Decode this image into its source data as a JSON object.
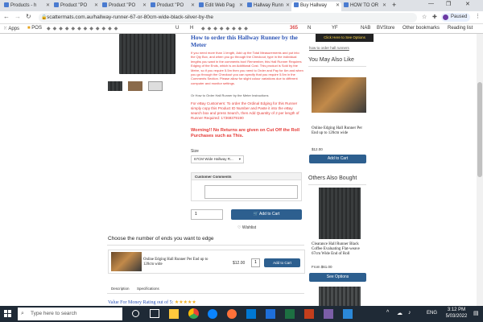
{
  "tabs": [
    {
      "label": "Products - h"
    },
    {
      "label": "Product \"PO"
    },
    {
      "label": "Product \"PO"
    },
    {
      "label": "Product \"PO"
    },
    {
      "label": "Edit Web Pag"
    },
    {
      "label": "Hallway Runn"
    },
    {
      "label": "Buy Hallway"
    },
    {
      "label": "HOW TO OR"
    }
  ],
  "browser": {
    "url": "scattermats.com.au/hallway-runner-67-or-80cm-wide-black-silver-by-the",
    "profile": "Paused"
  },
  "bookmarks": [
    {
      "label": "Apps"
    },
    {
      "label": "POS"
    },
    {
      "label": "U"
    },
    {
      "label": "H"
    },
    {
      "label": "365"
    },
    {
      "label": "N"
    },
    {
      "label": "YF"
    },
    {
      "label": "NAB"
    },
    {
      "label": "BVStore"
    }
  ],
  "bookmarks_right": {
    "other": "Other bookmarks",
    "reading": "Reading list"
  },
  "product": {
    "heading": "How to order this Hallway Runner by the Meter",
    "instructions": "If you need more than 1 length, Add up the Total Measurements and put into the Qty Box, and when you go through the Checkout, type in the individual lengths you want in the comments box! Remember, this Hall Runner Requires Edging of the Ends, which is an Additional Cost. This product is Sold by the Metre, so if you require 5.5m then you need to Order and Pay for 6m and when you go through the Checkout you can specify that you require 5.5m in the Comments Section. Please allow for slight colour variations due to different computer and monitor settings.",
    "link": "Or How to Order Hall Runner by the Meter Instructions",
    "ebay": "For eBay Customers: To order the Ordinal Edging for this Runner simply copy this Product ID Number and Paste it into the eBay search box and press Search, then Add Quantity of 2 per length of Runner Required: 17369379190",
    "warning": "Worning!! No Returns are given on Cut Off the Roll Purchases such as This.",
    "size_label": "Size",
    "size_value": "67CM Wide Hallway R...",
    "comments_label": "Customer Comments",
    "qty": "1",
    "add_to_cart": "Add to Cart",
    "wishlist": "Wishlist"
  },
  "edges": {
    "title": "Choose the number of ends you want to edge",
    "item_name": "Online Edging Hall Runner Per End up to 120cm wide",
    "price": "$12.00",
    "qty": "1",
    "add": "Add to Cart"
  },
  "tabs_section": {
    "description": "Description",
    "specs": "Specifications"
  },
  "rating": {
    "label": "Value For Money Rating out of 5:",
    "stars": "★★★★★"
  },
  "sidebar": {
    "banner": "Click Here to See Options",
    "banner_link": "how to order hall runners",
    "also_like": "You May Also Like",
    "also_like_item": "Online Edging Hall Runner Per End up to 120cm wide",
    "also_like_price": "$12.00",
    "also_like_btn": "Add to Cart",
    "also_bought": "Others Also Bought",
    "also_bought_item": "Clearance Hall Runner Black Coffee Evaluating Flat-weave 67cm Wide End of Roll",
    "also_bought_price": "From $61.00",
    "also_bought_btn": "See Options"
  },
  "taskbar": {
    "search": "Type here to search",
    "lang": "ENG",
    "time": "3:12 PM",
    "date": "5/03/2022"
  },
  "colors": {
    "accent": "#2d5f8f",
    "warning": "#e53935",
    "heading": "#2d55b6"
  }
}
